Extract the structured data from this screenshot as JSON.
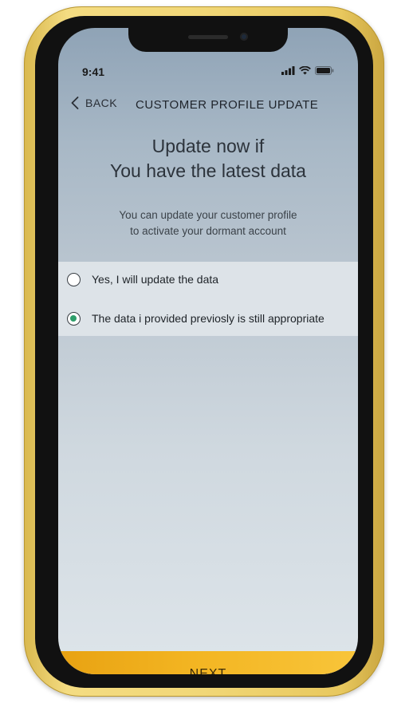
{
  "status_bar": {
    "time": "9:41"
  },
  "header": {
    "back_label": "BACK",
    "title": "CUSTOMER PROFILE UPDATE"
  },
  "headline": {
    "line1": "Update now if",
    "line2": "You have the latest data"
  },
  "subtext": {
    "line1": "You can update your customer profile",
    "line2": "to activate your dormant account"
  },
  "options": [
    {
      "label": "Yes, I will update the data",
      "selected": false
    },
    {
      "label": "The data i provided previosly is still appropriate",
      "selected": true
    }
  ],
  "next_button": {
    "label": "NEXT"
  },
  "colors": {
    "accent": "#f3b522",
    "radio_selected": "#2e9e6b",
    "phone_frame": "#f1d777"
  },
  "icons": [
    "chevron-left-icon",
    "signal-icon",
    "wifi-icon",
    "battery-icon"
  ]
}
